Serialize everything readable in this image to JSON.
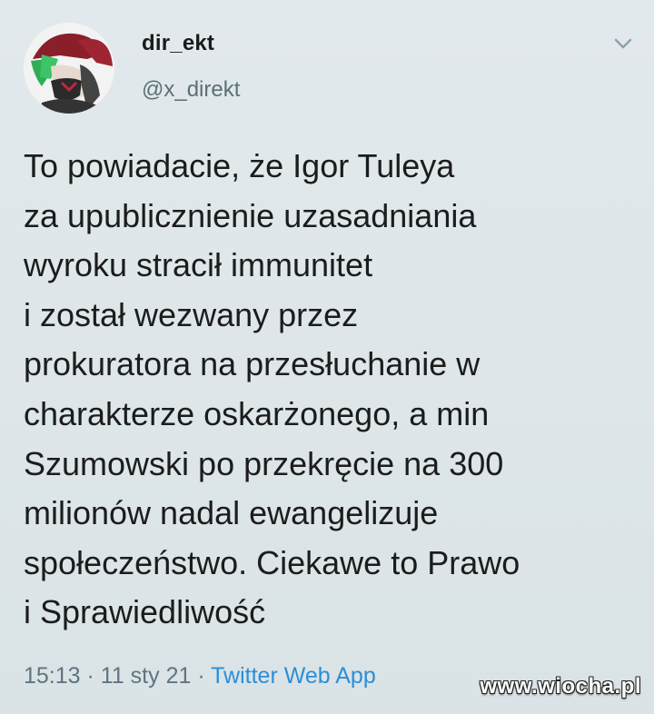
{
  "user": {
    "display_name": "dir_ekt",
    "handle": "@x_direkt",
    "avatar_icon": "avatar-icon"
  },
  "menu": {
    "icon": "chevron-down-icon"
  },
  "tweet": {
    "lines": [
      "To powiadacie, że Igor Tuleya",
      "za upublicznienie uzasadniania",
      "wyroku stracił immunitet",
      "i został wezwany przez",
      "prokuratora na przesłuchanie w",
      "charakterze oskarżonego, a min",
      "Szumowski po przekręcie na 300",
      "milionów nadal ewangelizuje",
      "społeczeństwo. Ciekawe to Prawo",
      "i Sprawiedliwość"
    ]
  },
  "meta": {
    "time": "15:13",
    "separator": " · ",
    "date": "11 sty 21",
    "source": "Twitter Web App"
  },
  "watermark": {
    "text": "www.wiocha.pl"
  },
  "colors": {
    "background": "#dde5e8",
    "text": "#1c1c1c",
    "secondary": "#5f7480",
    "link": "#2b8fd6"
  }
}
